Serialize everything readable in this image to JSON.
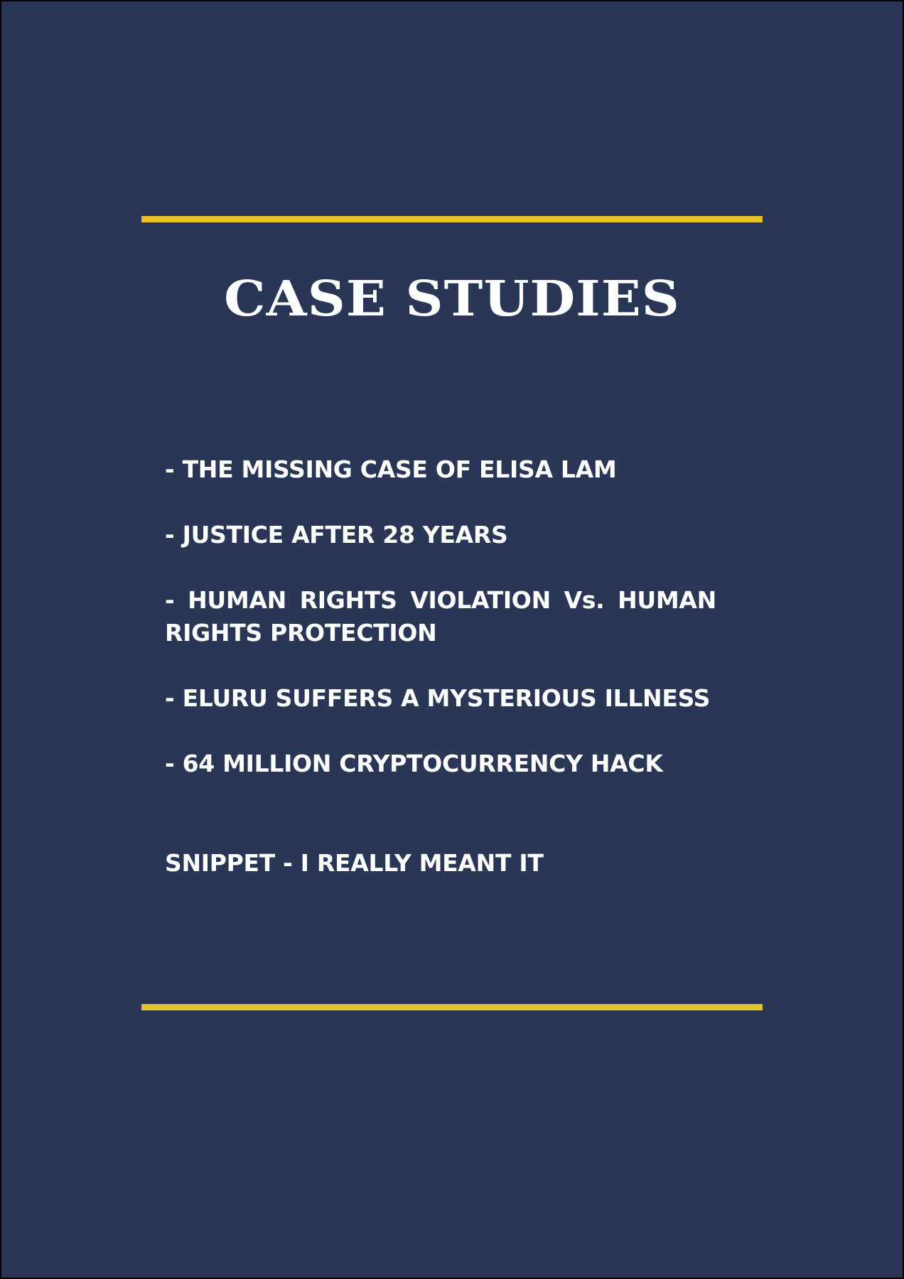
{
  "page": {
    "title": "CASE STUDIES",
    "items": [
      "- THE MISSING CASE OF ELISA LAM",
      "- JUSTICE AFTER 28 YEARS",
      "- HUMAN RIGHTS VIOLATION Vs. HUMAN RIGHTS PROTECTION",
      "- ELURU SUFFERS A MYSTERIOUS ILLNESS",
      "- 64 MILLION CRYPTOCURRENCY HACK"
    ],
    "snippet": "SNIPPET - I REALLY MEANT IT"
  },
  "colors": {
    "background": "#2a3656",
    "accent": "#e9bf2a",
    "text": "#ffffff"
  }
}
